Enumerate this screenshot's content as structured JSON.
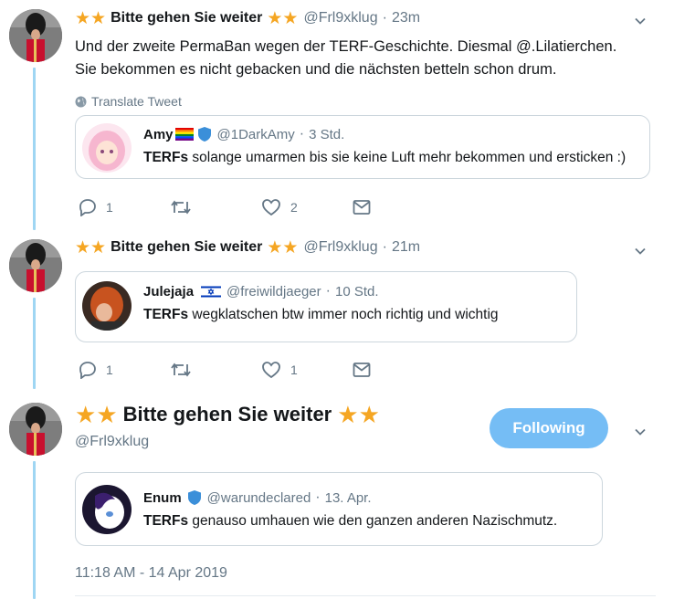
{
  "tweets": [
    {
      "name": "Bitte gehen Sie weiter",
      "handle": "@Frl9xklug",
      "time": "23m",
      "text_line1": "Und der zweite PermaBan wegen der TERF-Geschichte. Diesmal @.Lilatierchen.",
      "text_line2": "Sie bekommen es nicht gebacken und die nächsten betteln schon drum.",
      "translate": "Translate Tweet",
      "quote": {
        "name": "Amy",
        "handle": "@1DarkAmy",
        "time": "3 Std.",
        "text_bold": "TERFs",
        "text_rest": " solange umarmen bis sie keine Luft mehr bekommen und ersticken :)"
      },
      "replies": "1",
      "retweets": "",
      "likes": "2"
    },
    {
      "name": "Bitte gehen Sie weiter",
      "handle": "@Frl9xklug",
      "time": "21m",
      "quote": {
        "name": "Julejaja",
        "handle": "@freiwildjaeger",
        "time": "10 Std.",
        "text_bold": "TERFs",
        "text_rest": " wegklatschen btw immer noch richtig und wichtig"
      },
      "replies": "1",
      "retweets": "",
      "likes": "1"
    }
  ],
  "main_tweet": {
    "name": "Bitte gehen Sie weiter",
    "handle": "@Frl9xklug",
    "follow_label": "Following",
    "quote": {
      "name": "Enum",
      "handle": "@warundeclared",
      "time": "13. Apr.",
      "text_bold": "TERFs",
      "text_rest": " genauso umhauen wie den ganzen anderen Nazischmutz."
    },
    "timestamp": "11:18 AM - 14 Apr 2019"
  },
  "separator": "·",
  "icons": [
    "star-icon",
    "chevron-down-icon",
    "globe-icon",
    "reply-icon",
    "retweet-icon",
    "like-icon",
    "direct-message-icon",
    "rainbow-flag-icon",
    "shield-icon",
    "israel-flag-icon"
  ],
  "colors": {
    "accent": "#1da1f2",
    "follow_button": "#75bdf5",
    "thread_line": "#9fd6f3",
    "star": "#f5a623",
    "secondary_text": "#657786"
  }
}
